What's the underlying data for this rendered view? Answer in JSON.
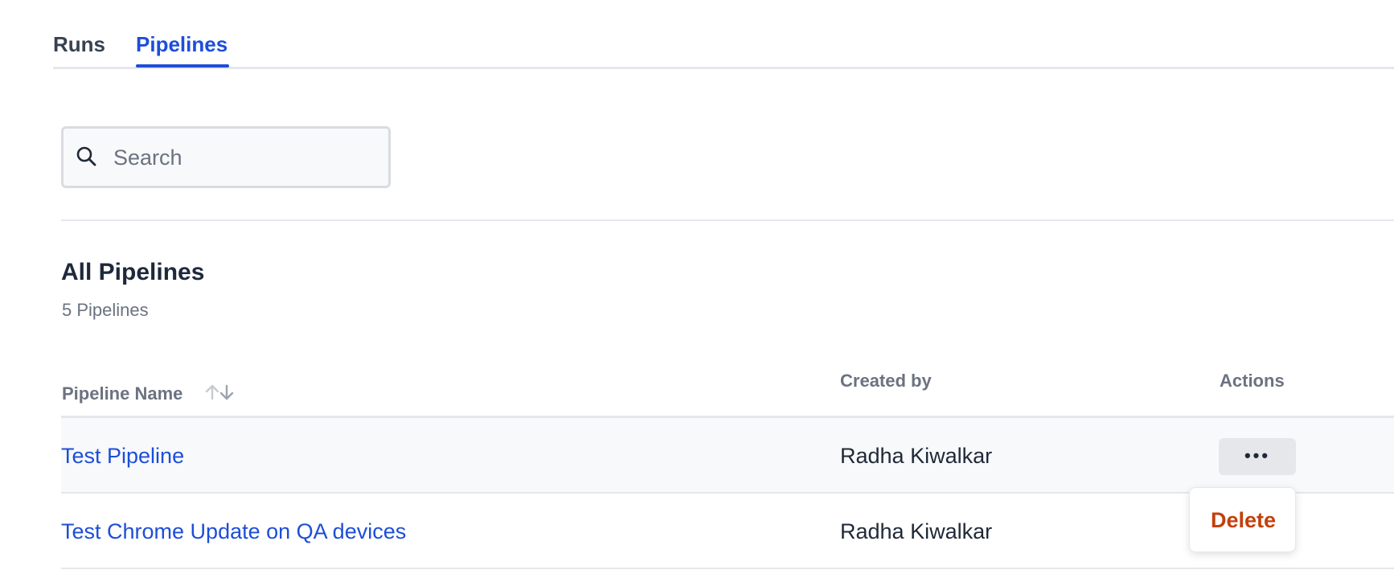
{
  "tabs": [
    {
      "label": "Runs",
      "active": false
    },
    {
      "label": "Pipelines",
      "active": true
    }
  ],
  "search": {
    "placeholder": "Search",
    "value": ""
  },
  "section": {
    "title": "All Pipelines",
    "count": "5 Pipelines"
  },
  "table": {
    "headers": {
      "name": "Pipeline Name",
      "created_by": "Created by",
      "actions": "Actions"
    },
    "rows": [
      {
        "name": "Test Pipeline",
        "created_by": "Radha Kiwalkar",
        "actions_label": "•••"
      },
      {
        "name": "Test Chrome Update on QA devices",
        "created_by": "Radha Kiwalkar"
      }
    ]
  },
  "dropdown": {
    "items": [
      {
        "label": "Delete",
        "color": "#c2410c"
      }
    ]
  },
  "icons": {
    "search": "search-icon",
    "sort": "sort-arrows-icon",
    "more": "more-horizontal-icon"
  },
  "colors": {
    "accent": "#1d4ed8",
    "danger": "#c2410c",
    "muted": "#6b7280",
    "row_highlight": "#f8f9fb"
  }
}
